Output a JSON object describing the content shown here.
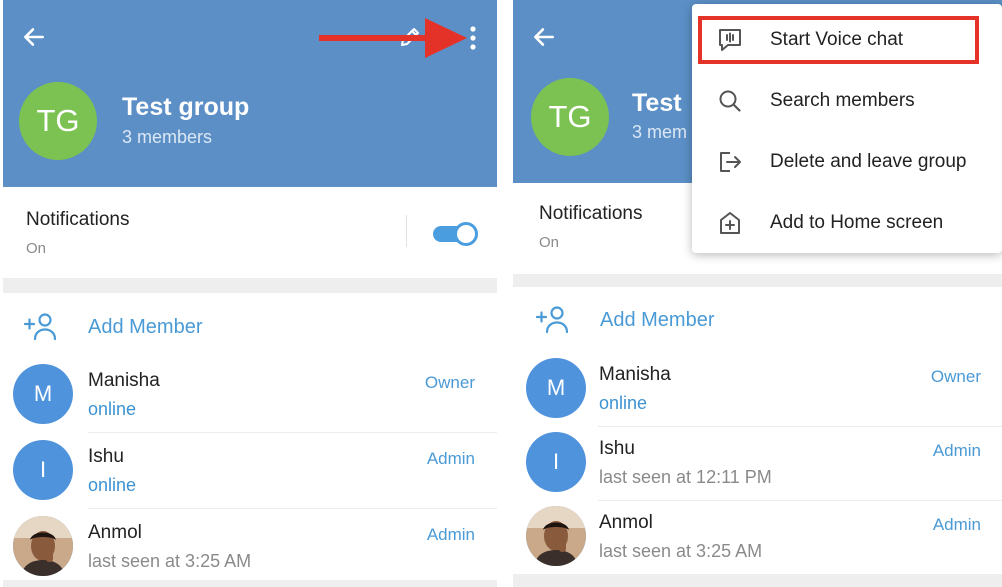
{
  "colors": {
    "header_bg": "#5b8fc6",
    "group_avatar": "#7cc252",
    "member_avatar": "#4f93dd",
    "accent": "#4a9ad6",
    "toggle": "#4a9ee0",
    "annotation_red": "#e53228"
  },
  "icons": {
    "back": "arrow-left-icon",
    "edit": "pencil-icon",
    "more": "vertical-dots-icon",
    "add_member": "person-plus-icon",
    "voice_chat": "voice-chat-icon",
    "search": "search-icon",
    "leave": "exit-icon",
    "home": "add-to-home-icon"
  },
  "left": {
    "group": {
      "initials": "TG",
      "title": "Test group",
      "subtitle": "3 members"
    },
    "notifications": {
      "title": "Notifications",
      "status": "On",
      "enabled": true
    },
    "add_member_label": "Add Member",
    "members": [
      {
        "initial": "M",
        "name": "Manisha",
        "status": "online",
        "status_type": "online",
        "role": "Owner"
      },
      {
        "initial": "I",
        "name": "Ishu",
        "status": "online",
        "status_type": "online",
        "role": "Admin"
      },
      {
        "initial": "",
        "name": "Anmol",
        "status": "last seen at 3:25 AM",
        "status_type": "seen",
        "role": "Admin",
        "photo": true
      }
    ]
  },
  "right": {
    "group": {
      "initials": "TG",
      "title_partial": "Test",
      "subtitle_partial": "3 mem"
    },
    "notifications": {
      "title": "Notifications",
      "status": "On"
    },
    "menu": [
      {
        "label": "Start Voice chat",
        "icon": "voice-chat-icon",
        "highlighted": true
      },
      {
        "label": "Search members",
        "icon": "search-icon"
      },
      {
        "label": "Delete and leave group",
        "icon": "exit-icon"
      },
      {
        "label": "Add to Home screen",
        "icon": "add-to-home-icon"
      }
    ],
    "add_member_label": "Add Member",
    "members": [
      {
        "initial": "M",
        "name": "Manisha",
        "status": "online",
        "status_type": "online",
        "role": "Owner"
      },
      {
        "initial": "I",
        "name": "Ishu",
        "status": "last seen at 12:11 PM",
        "status_type": "seen",
        "role": "Admin"
      },
      {
        "initial": "",
        "name": "Anmol",
        "status": "last seen at 3:25 AM",
        "status_type": "seen",
        "role": "Admin",
        "photo": true
      }
    ]
  }
}
